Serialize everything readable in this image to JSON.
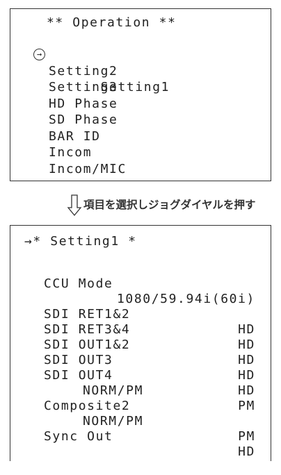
{
  "operation_menu": {
    "title": "** Operation **",
    "cursor_glyph": "→",
    "selected_index": 0,
    "items": [
      "Setting1",
      "Setting2",
      "Setting3",
      "HD Phase",
      "SD Phase",
      "BAR ID",
      "Incom",
      "Incom/MIC"
    ]
  },
  "instruction": {
    "icon": "down-arrow-icon",
    "text": "項目を選択しジョグダイヤルを押す"
  },
  "setting1_menu": {
    "title": "→* Setting1 *",
    "ccu_mode_label": "CCU Mode",
    "ccu_mode_value": "1080/59.94i(60i)",
    "rows": [
      {
        "label": "SDI RET1&2",
        "value": "HD"
      },
      {
        "label": "SDI RET3&4",
        "value": "HD"
      },
      {
        "label": "SDI OUT1&2",
        "value": "HD"
      },
      {
        "label": "SDI OUT3",
        "value": "HD"
      },
      {
        "label": "SDI OUT4",
        "value": "HD"
      }
    ],
    "norm_pm_1_label": "NORM/PM",
    "norm_pm_1_value": "PM",
    "composite2_label": "Composite2",
    "norm_pm_2_label": "NORM/PM",
    "norm_pm_2_value": "PM",
    "sync_out_label": "Sync Out",
    "sync_out_value": "HD"
  }
}
